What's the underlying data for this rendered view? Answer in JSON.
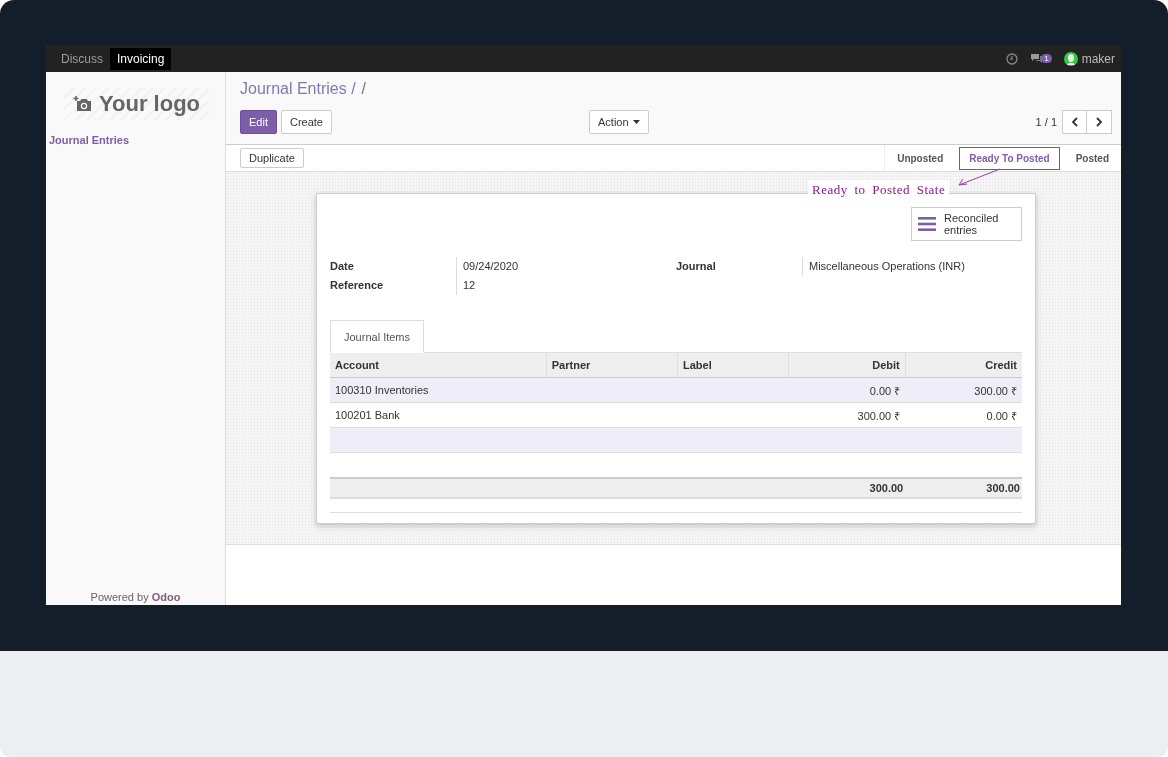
{
  "navbar": {
    "apps": [
      {
        "label": "Discuss",
        "selected": false
      },
      {
        "label": "Invoicing",
        "selected": true
      }
    ],
    "messages_badge": "1",
    "user": "maker"
  },
  "sidebar": {
    "logo": "Your logo",
    "menu": [
      {
        "label": "Journal Entries",
        "selected": true
      }
    ],
    "footer_text": "Powered by",
    "footer_link": "Odoo"
  },
  "breadcrumb": [
    "Journal Entries /",
    "/"
  ],
  "buttons": {
    "edit": "Edit",
    "create": "Create",
    "action": "Action",
    "pager": "1 / 1",
    "duplicate": "Duplicate"
  },
  "stages": [
    {
      "label": "Unposted",
      "selected": false
    },
    {
      "label": "Ready To Posted",
      "selected": true
    },
    {
      "label": "Posted",
      "selected": false
    }
  ],
  "annotation": "Ready to Posted State",
  "smart_button": "Reconciled entries",
  "fields_left": [
    {
      "label": "Date",
      "value": "09/24/2020"
    },
    {
      "label": "Reference",
      "value": "12"
    }
  ],
  "fields_right": [
    {
      "label": "Journal",
      "value": "Miscellaneous Operations (INR)"
    }
  ],
  "tabs": [
    {
      "label": "Journal Items",
      "selected": true
    }
  ],
  "table": {
    "columns": [
      "Account",
      "Partner",
      "Label",
      "Debit",
      "Credit"
    ],
    "rows": [
      [
        "100310 Inventories",
        "",
        "",
        "0.00 ₹",
        "300.00 ₹"
      ],
      [
        "100201 Bank",
        "",
        "",
        "300.00 ₹",
        "0.00 ₹"
      ]
    ],
    "totals": [
      "300.00",
      "300.00"
    ]
  }
}
